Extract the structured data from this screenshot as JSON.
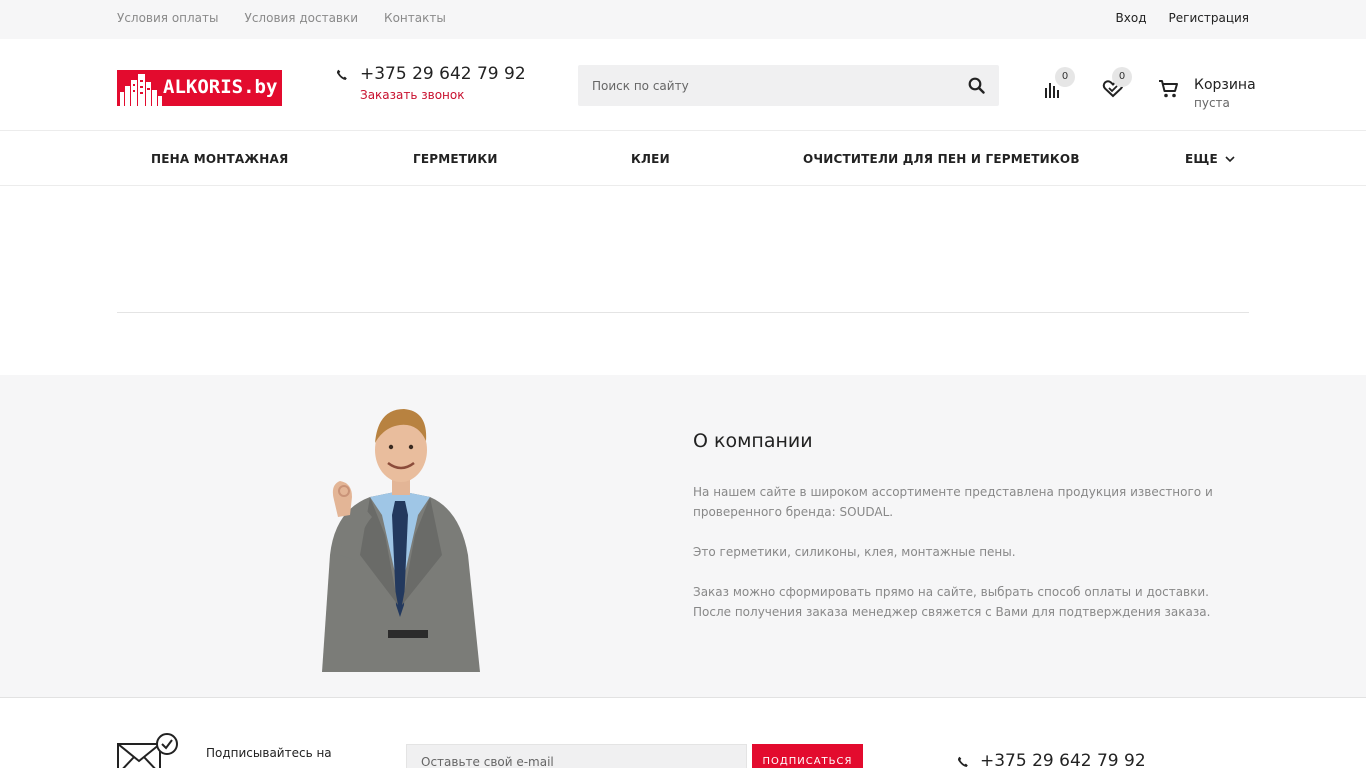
{
  "topbar": {
    "links": [
      "Условия оплаты",
      "Условия доставки",
      "Контакты"
    ],
    "login": "Вход",
    "register": "Регистрация"
  },
  "header": {
    "logo_text": "ALKORIS.by",
    "phone": "+375 29 642 79 92",
    "callback": "Заказать звонок",
    "search_placeholder": "Поиск по сайту",
    "compare_count": "0",
    "favorites_count": "0",
    "cart_title": "Корзина",
    "cart_status": "пуста"
  },
  "nav": {
    "items": [
      "ПЕНА МОНТАЖНАЯ",
      "ГЕРМЕТИКИ",
      "КЛЕИ",
      "ОЧИСТИТЕЛИ ДЛЯ ПЕН И ГЕРМЕТИКОВ"
    ],
    "more": "ЕЩЕ"
  },
  "about": {
    "title": "О компании",
    "paragraphs": [
      "На нашем сайте в широком ассортименте представлена продукция известного и проверенного бренда: SOUDAL.",
      "Это герметики, силиконы, клея, монтажные пены.",
      "Заказ можно сформировать прямо на сайте, выбрать способ оплаты и доставки. После получения заказа менеджер свяжется с Вами для подтверждения заказа."
    ]
  },
  "footer": {
    "subscribe_text": "Подписывайтесь на новости и акции",
    "email_placeholder": "Оставьте свой e-mail",
    "subscribe_button": "подписаться",
    "phone": "+375 29 642 79 92"
  },
  "colors": {
    "brand_red": "#e30b2e",
    "link_red": "#c8102e",
    "light_bg": "#f6f6f7"
  }
}
